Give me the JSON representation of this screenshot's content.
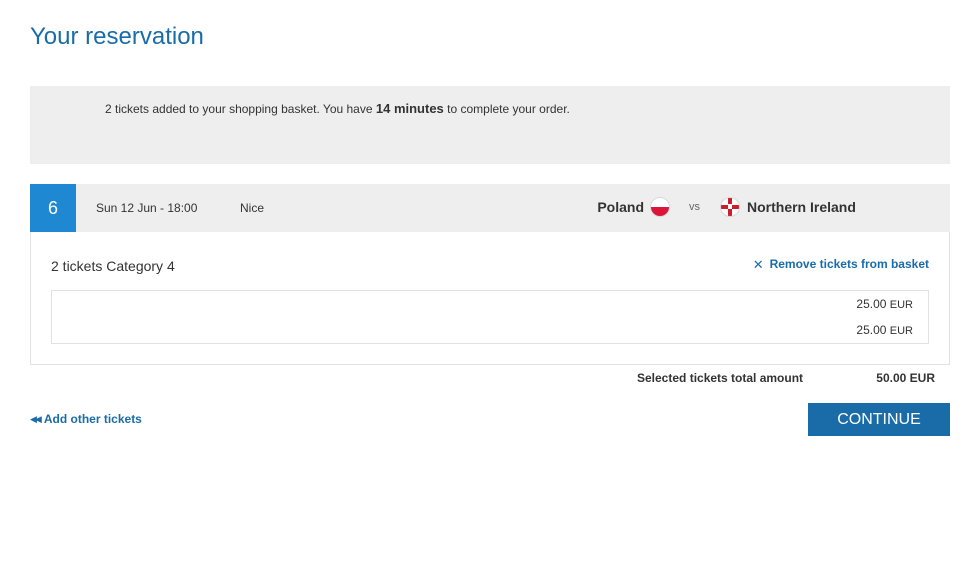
{
  "page": {
    "title": "Your reservation"
  },
  "notice": {
    "prefix": "2 tickets added to your shopping basket. You have ",
    "time": "14 minutes",
    "suffix": " to complete your order."
  },
  "match": {
    "number": "6",
    "date": "Sun 12 Jun - 18:00",
    "city": "Nice",
    "home_team": "Poland",
    "vs": "vs",
    "away_team": "Northern Ireland",
    "home_flag_icon": "poland-flag-icon",
    "away_flag_icon": "northern-ireland-flag-icon"
  },
  "basket": {
    "category": "2 tickets Category 4",
    "remove_label": "Remove tickets from basket",
    "remove_icon": "close-icon",
    "tickets": [
      {
        "price": "25.00",
        "currency": "EUR"
      },
      {
        "price": "25.00",
        "currency": "EUR"
      }
    ]
  },
  "totals": {
    "label": "Selected tickets total amount",
    "amount": "50.00 EUR"
  },
  "actions": {
    "add_other_label": "Add other tickets",
    "add_other_icon": "rewind-icon",
    "continue_label": "CONTINUE"
  },
  "colors": {
    "accent": "#1a6ca8",
    "match_number_bg": "#1e88d2",
    "panel_bg": "#eeeeee"
  }
}
